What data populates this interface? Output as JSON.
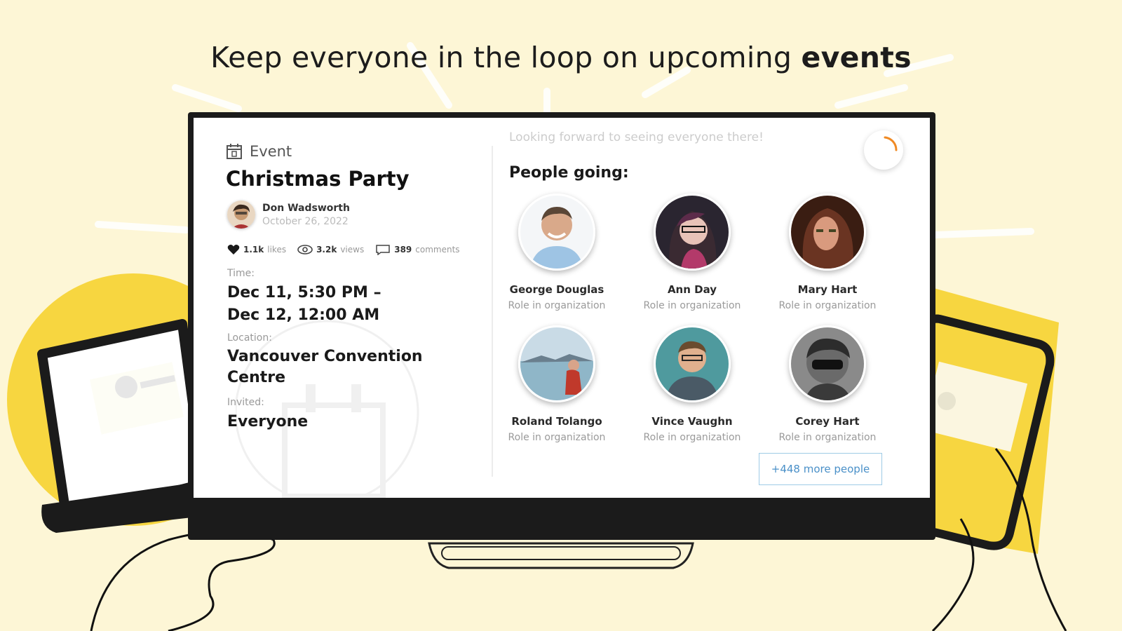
{
  "headline": {
    "text": "Keep everyone in the loop on upcoming ",
    "bold": "events"
  },
  "event": {
    "type_label": "Event",
    "title": "Christmas Party",
    "author": "Don Wadsworth",
    "date": "October 26, 2022",
    "likes_count": "1.1k",
    "likes_label": "likes",
    "views_count": "3.2k",
    "views_label": "views",
    "comments_count": "389",
    "comments_label": "comments",
    "time_label": "Time:",
    "time_line1": "Dec 11, 5:30 PM –",
    "time_line2": "Dec 12, 12:00 AM",
    "location_label": "Location:",
    "location_line1": "Vancouver Convention",
    "location_line2": "Centre",
    "invited_label": "Invited:",
    "invited_value": "Everyone"
  },
  "right": {
    "tagline": "Looking forward to seeing everyone there!",
    "going_title": "People going:",
    "people": [
      {
        "name": "George Douglas",
        "role": "Role in organization"
      },
      {
        "name": "Ann Day",
        "role": "Role in organization"
      },
      {
        "name": "Mary Hart",
        "role": "Role in organization"
      },
      {
        "name": "Roland Tolango",
        "role": "Role in organization"
      },
      {
        "name": "Vince Vaughn",
        "role": "Role in organization"
      },
      {
        "name": "Corey Hart",
        "role": "Role in organization"
      }
    ],
    "more_button": "+448 more people"
  },
  "colors": {
    "background": "#fdf6d6",
    "accent_yellow": "#f7d640",
    "link_blue": "#4a90c8",
    "spinner_orange": "#f08a24"
  }
}
